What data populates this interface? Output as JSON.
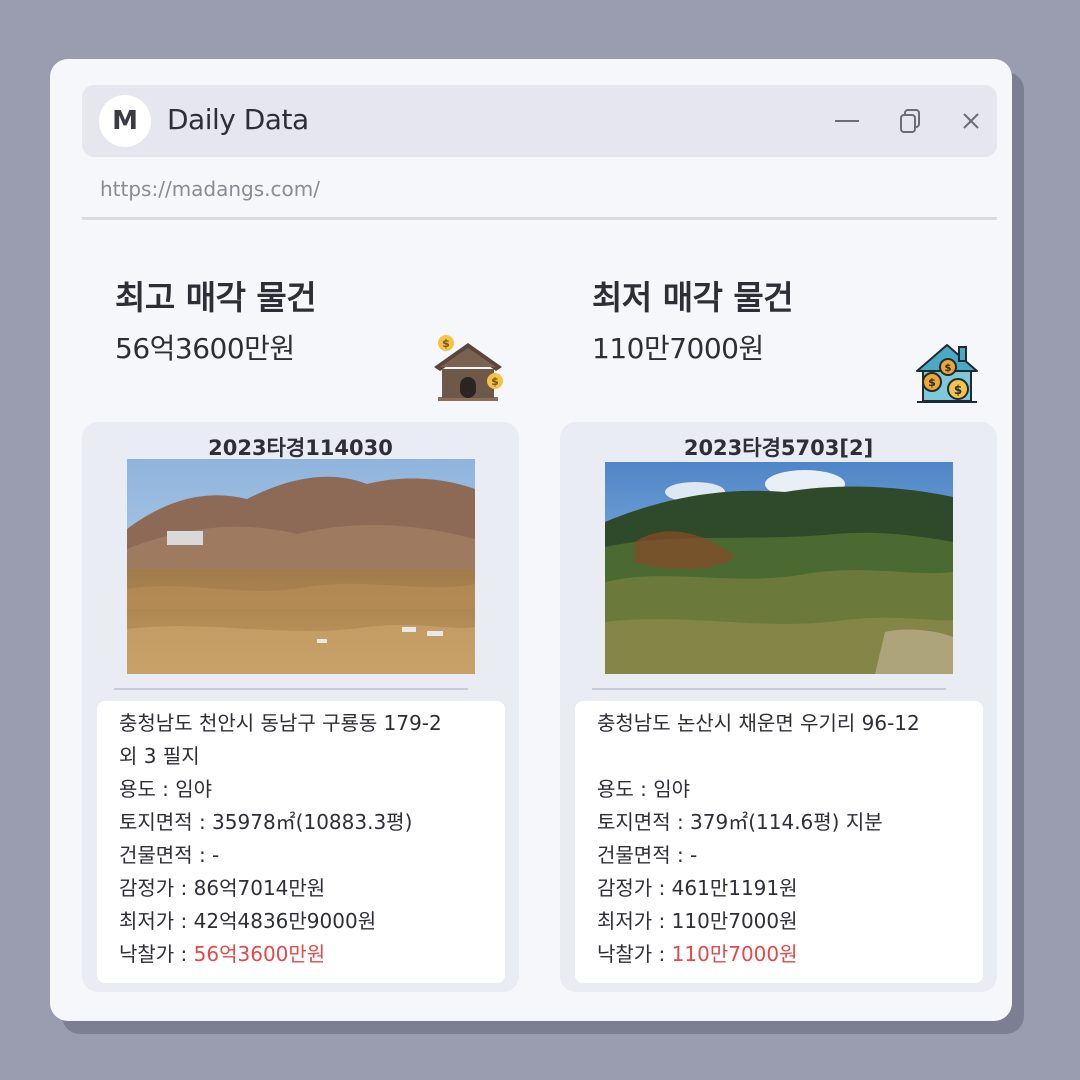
{
  "window": {
    "logo_letter": "M",
    "title": "Daily Data",
    "url": "https://madangs.com/",
    "buttons": [
      "minimize-icon",
      "restore-icon",
      "close-icon"
    ]
  },
  "highest": {
    "heading": "최고 매각 물건",
    "amount": "56억3600만원",
    "icon": "house-money-icon",
    "case_no": "2023타경114030",
    "address_line1": "충청남도 천안시 동남구 구룡동 179-2",
    "address_line2": "외 3 필지",
    "usage": "용도 : 임야",
    "land_area": "토지면적 : 35978㎡(10883.3평)",
    "building_area": "건물면적 :  -",
    "appraisal": "감정가 : 86억7014만원",
    "minimum": "최저가 : 42억4836만9000원",
    "winning_label": "낙찰가 : ",
    "winning_price": "56억3600만원"
  },
  "lowest": {
    "heading": "최저 매각 물건",
    "amount": "110만7000원",
    "icon": "house-coins-icon",
    "case_no": "2023타경5703[2]",
    "address_line1": "충청남도 논산시 채운면 우기리 96-12",
    "usage": "용도 :  임야",
    "land_area": "토지면적 : 379㎡(114.6평) 지분",
    "building_area": "건물면적 : -",
    "appraisal": "감정가 : 461만1191원",
    "minimum": "최저가 : 110만7000원",
    "winning_label": "낙찰가 : ",
    "winning_price": "110만7000원"
  },
  "colors": {
    "background": "#9a9cb0",
    "window": "#f6f7fb",
    "titlebar": "#e6e7ee",
    "card": "#eaecf4",
    "price_red": "#e24a4a"
  }
}
